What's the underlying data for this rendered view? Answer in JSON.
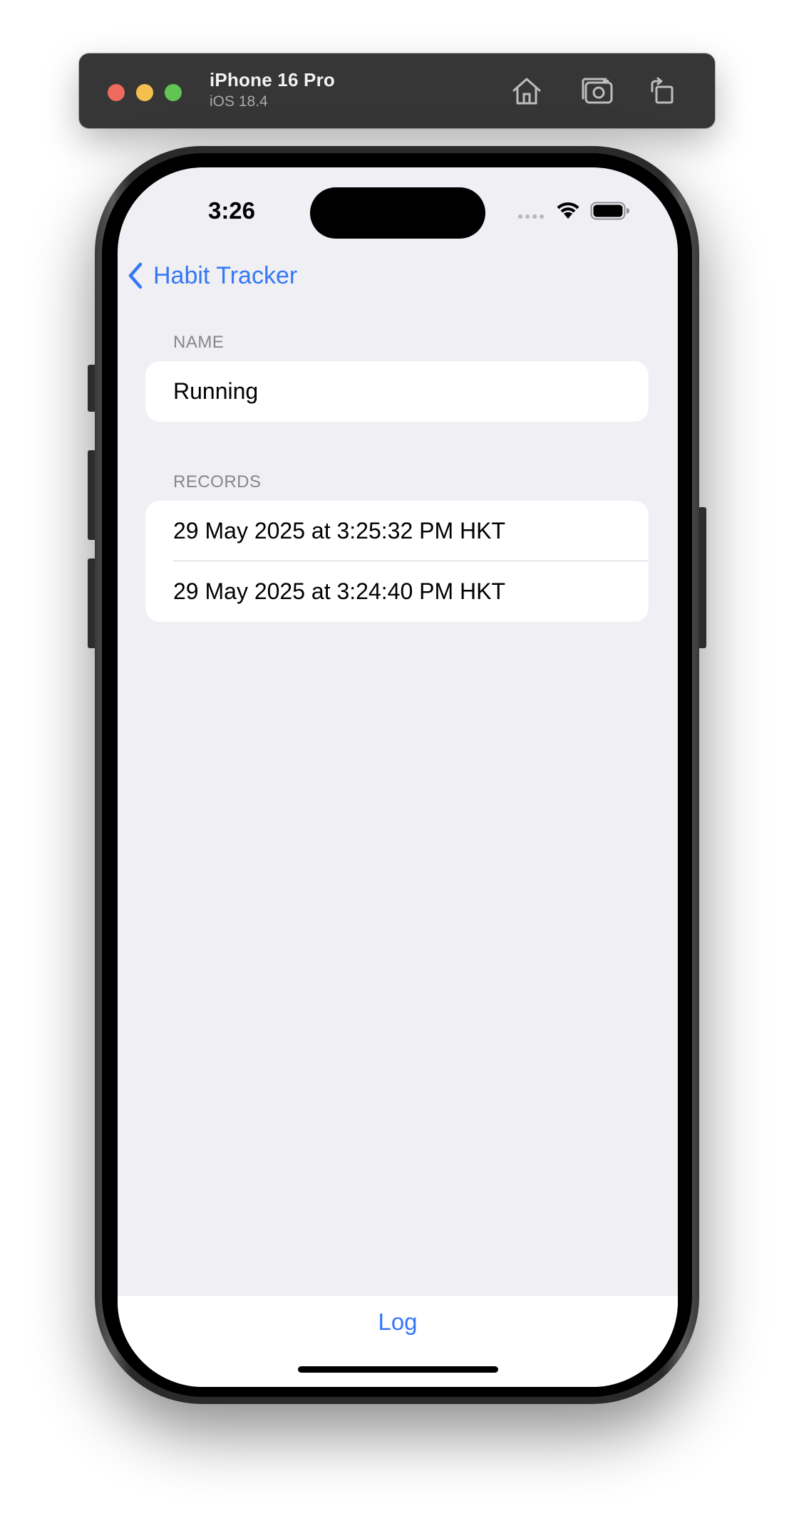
{
  "simulator": {
    "device_name": "iPhone 16 Pro",
    "os_version": "iOS 18.4",
    "toolbar_icons": [
      "home-icon",
      "screenshot-icon",
      "rotate-icon"
    ]
  },
  "status_bar": {
    "time": "3:26"
  },
  "nav": {
    "back_label": "Habit Tracker"
  },
  "sections": {
    "name_header": "NAME",
    "name_value": "Running",
    "records_header": "RECORDS",
    "records": [
      "29 May 2025 at 3:25:32 PM HKT",
      "29 May 2025 at 3:24:40 PM HKT"
    ]
  },
  "toolbar": {
    "log_label": "Log"
  },
  "colors": {
    "accent": "#3478f6",
    "background": "#efeff4",
    "cell": "#ffffff",
    "secondary_text": "#86868b"
  }
}
